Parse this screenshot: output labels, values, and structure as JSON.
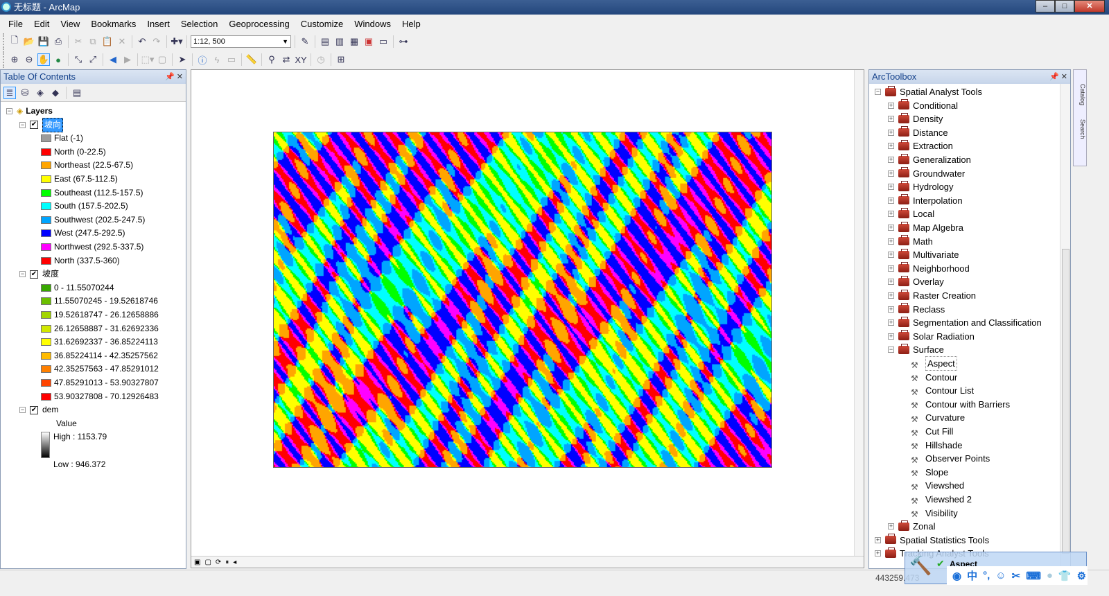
{
  "window": {
    "title": "无标题 - ArcMap"
  },
  "menu": [
    "File",
    "Edit",
    "View",
    "Bookmarks",
    "Insert",
    "Selection",
    "Geoprocessing",
    "Customize",
    "Windows",
    "Help"
  ],
  "toolbar": {
    "scale": "1:12, 500"
  },
  "toc": {
    "title": "Table Of Contents",
    "root": "Layers",
    "layers": [
      {
        "name": "坡向",
        "selected": true,
        "classes": [
          {
            "label": "Flat (-1)",
            "color": "#9c9c9c"
          },
          {
            "label": "North (0-22.5)",
            "color": "#ff0000"
          },
          {
            "label": "Northeast (22.5-67.5)",
            "color": "#ffa500"
          },
          {
            "label": "East (67.5-112.5)",
            "color": "#ffff00"
          },
          {
            "label": "Southeast (112.5-157.5)",
            "color": "#00ff00"
          },
          {
            "label": "South (157.5-202.5)",
            "color": "#00ffff"
          },
          {
            "label": "Southwest (202.5-247.5)",
            "color": "#00a5ff"
          },
          {
            "label": "West (247.5-292.5)",
            "color": "#0000ff"
          },
          {
            "label": "Northwest (292.5-337.5)",
            "color": "#ff00ff"
          },
          {
            "label": "North (337.5-360)",
            "color": "#ff0000"
          }
        ]
      },
      {
        "name": "坡度",
        "classes": [
          {
            "label": "0 - 11.55070244",
            "color": "#38a800"
          },
          {
            "label": "11.55070245 - 19.52618746",
            "color": "#6bbf00"
          },
          {
            "label": "19.52618747 - 26.12658886",
            "color": "#a3d600"
          },
          {
            "label": "26.12658887 - 31.62692336",
            "color": "#d1e800"
          },
          {
            "label": "31.62692337 - 36.85224113",
            "color": "#ffff00"
          },
          {
            "label": "36.85224114 - 42.35257562",
            "color": "#ffbb00"
          },
          {
            "label": "42.35257563 - 47.85291012",
            "color": "#ff8000"
          },
          {
            "label": "47.85291013 - 53.90327807",
            "color": "#ff4400"
          },
          {
            "label": "53.90327808 - 70.12926483",
            "color": "#ff0000"
          }
        ]
      },
      {
        "name": "dem",
        "value_label": "Value",
        "high": "High : 1153.79",
        "low": "Low : 946.372"
      }
    ]
  },
  "arctoolbox": {
    "title": "ArcToolbox",
    "root": "Spatial Analyst Tools",
    "toolsets": [
      "Conditional",
      "Density",
      "Distance",
      "Extraction",
      "Generalization",
      "Groundwater",
      "Hydrology",
      "Interpolation",
      "Local",
      "Map Algebra",
      "Math",
      "Multivariate",
      "Neighborhood",
      "Overlay",
      "Raster Creation",
      "Reclass",
      "Segmentation and Classification",
      "Solar Radiation",
      "Surface"
    ],
    "surface_tools": [
      "Aspect",
      "Contour",
      "Contour List",
      "Contour with Barriers",
      "Curvature",
      "Cut Fill",
      "Hillshade",
      "Observer Points",
      "Slope",
      "Viewshed",
      "Viewshed 2",
      "Visibility"
    ],
    "after": [
      "Zonal"
    ],
    "other_toolboxes": [
      "Spatial Statistics Tools",
      "Tracking Analyst Tools"
    ]
  },
  "side_tabs": [
    "Catalog",
    "Search"
  ],
  "status": {
    "coords": "443259.473"
  },
  "ime": {
    "tool": "Aspect",
    "lang": "中"
  }
}
